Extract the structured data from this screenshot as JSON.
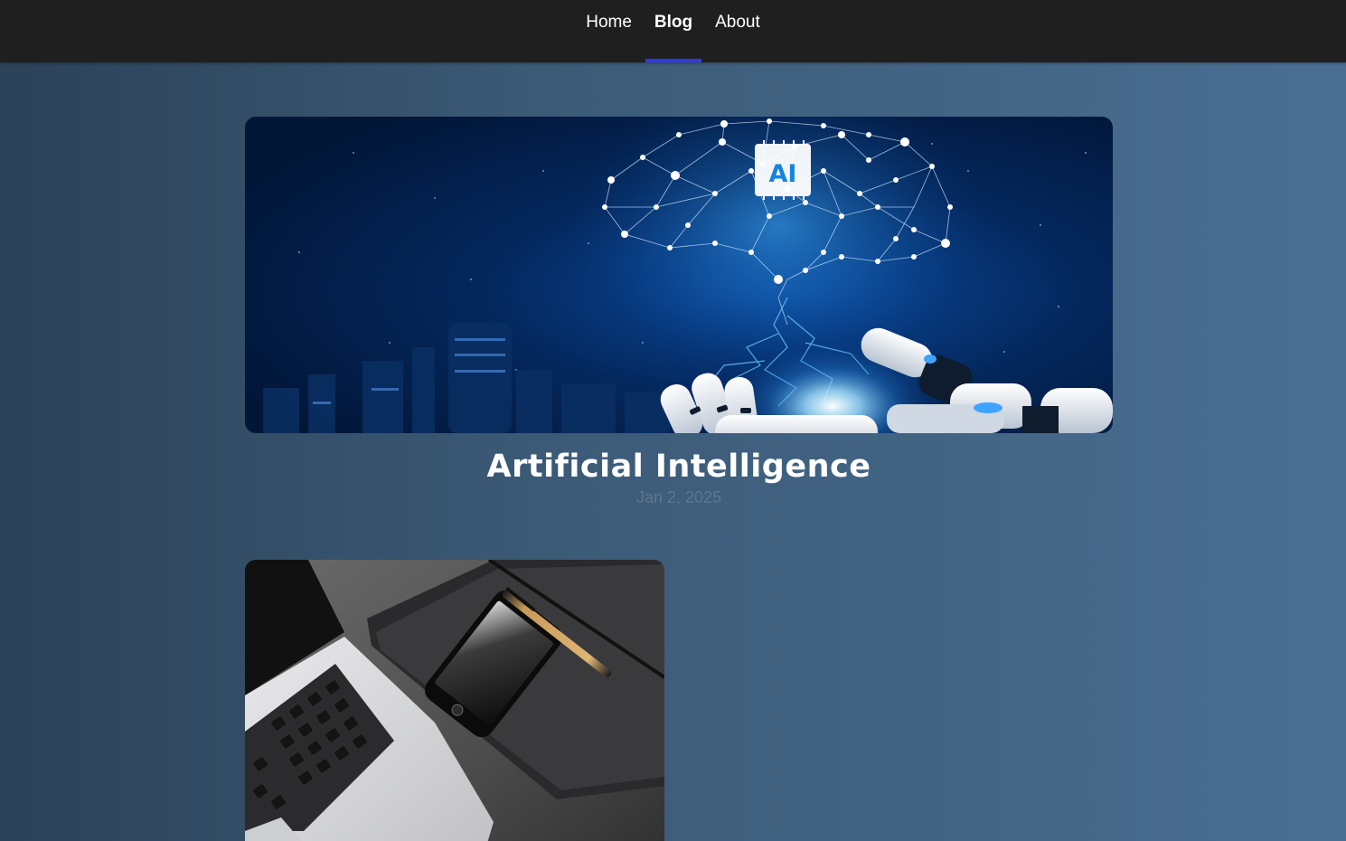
{
  "nav": {
    "items": [
      {
        "label": "Home",
        "active": false
      },
      {
        "label": "Blog",
        "active": true
      },
      {
        "label": "About",
        "active": false
      }
    ],
    "active_indicator_color": "#2e39e6",
    "background": "#1f1f1f"
  },
  "posts": [
    {
      "title": "Artificial Intelligence",
      "date": "Jan 2, 2025",
      "image_icon": "ai-brain-robot-hand-image",
      "badge": "AI"
    },
    {
      "title": "",
      "date": "",
      "image_icon": "laptop-phone-notebook-image"
    }
  ]
}
